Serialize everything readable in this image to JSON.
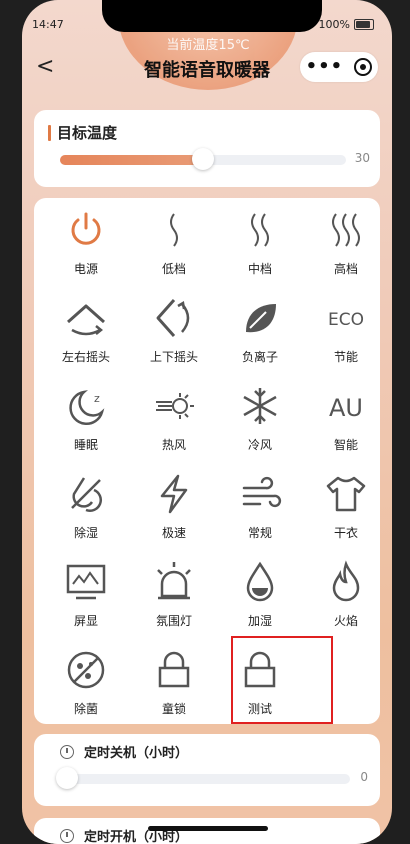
{
  "status": {
    "time": "14:47",
    "battery": "100%"
  },
  "header": {
    "current_temp": "当前温度15℃",
    "title": "智能语音取暖器",
    "back": "<"
  },
  "target_temp": {
    "title": "目标温度",
    "value": "30",
    "fraction": 0.5
  },
  "controls": [
    {
      "label": "电源",
      "icon": "power-icon"
    },
    {
      "label": "低档",
      "icon": "heat-wave-low-icon"
    },
    {
      "label": "中档",
      "icon": "heat-wave-mid-icon"
    },
    {
      "label": "高档",
      "icon": "heat-wave-high-icon"
    },
    {
      "label": "左右摇头",
      "icon": "horizontal-swing-icon"
    },
    {
      "label": "上下摇头",
      "icon": "vertical-swing-icon"
    },
    {
      "label": "负离子",
      "icon": "leaf-icon"
    },
    {
      "label": "节能",
      "icon": "eco-icon",
      "text": "ECO"
    },
    {
      "label": "睡眠",
      "icon": "moon-sleep-icon"
    },
    {
      "label": "热风",
      "icon": "warm-wind-sun-icon"
    },
    {
      "label": "冷风",
      "icon": "snowflake-icon"
    },
    {
      "label": "智能",
      "icon": "auto-icon",
      "text": "AU"
    },
    {
      "label": "除湿",
      "icon": "dehumidify-icon"
    },
    {
      "label": "极速",
      "icon": "lightning-icon"
    },
    {
      "label": "常规",
      "icon": "wind-icon"
    },
    {
      "label": "干衣",
      "icon": "shirt-icon"
    },
    {
      "label": "屏显",
      "icon": "display-icon"
    },
    {
      "label": "氛围灯",
      "icon": "alarm-light-icon"
    },
    {
      "label": "加湿",
      "icon": "water-drop-icon"
    },
    {
      "label": "火焰",
      "icon": "flame-icon"
    },
    {
      "label": "除菌",
      "icon": "sterilize-icon"
    },
    {
      "label": "童锁",
      "icon": "lock-icon"
    },
    {
      "label": "测试",
      "icon": "lock-icon"
    }
  ],
  "timers": [
    {
      "title": "定时关机（小时）",
      "value": "0"
    },
    {
      "title": "定时开机（小时）"
    }
  ],
  "colors": {
    "accent": "#e07a45",
    "highlight": "#e02020"
  }
}
